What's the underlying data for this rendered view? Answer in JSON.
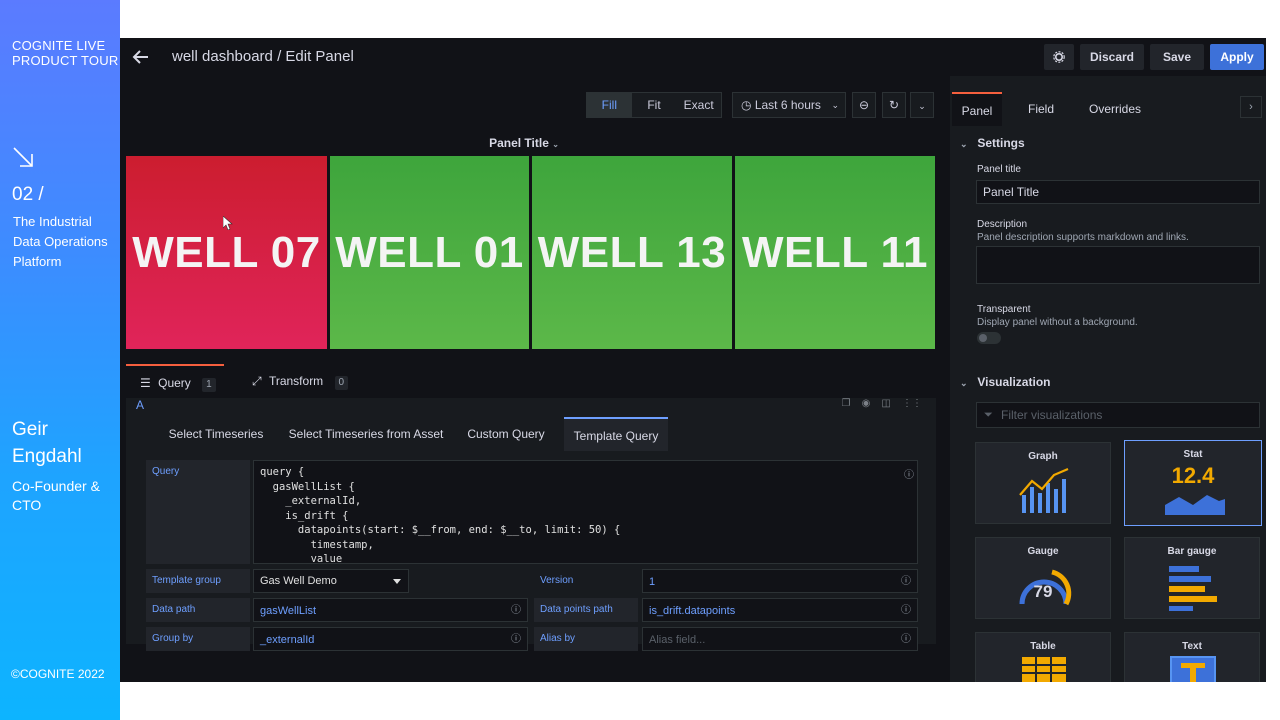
{
  "promo": {
    "brand_line1": "COGNITE LIVE",
    "brand_line2": "PRODUCT TOUR",
    "chapter_number": "02 /",
    "chapter_line1": "The Industrial",
    "chapter_line2": "Data Operations",
    "chapter_line3": "Platform",
    "person_first": "Geir",
    "person_last": "Engdahl",
    "role_line1": "Co-Founder &",
    "role_line2": "CTO",
    "copyright": "©COGNITE 2022"
  },
  "topbar": {
    "breadcrumb": "well dashboard / Edit Panel",
    "discard_label": "Discard",
    "save_label": "Save",
    "apply_label": "Apply"
  },
  "preview_controls": {
    "fill_label": "Fill",
    "fit_label": "Fit",
    "exact_label": "Exact",
    "time_range": "Last 6 hours"
  },
  "panel": {
    "title": "Panel Title",
    "stats": [
      {
        "label": "WELL 07",
        "status_color": "#d21f45"
      },
      {
        "label": "WELL 01",
        "status_color": "#4eae42"
      },
      {
        "label": "WELL 13",
        "status_color": "#4eae42"
      },
      {
        "label": "WELL 11",
        "status_color": "#4eae42"
      }
    ]
  },
  "query_tabs": {
    "query_label": "Query",
    "query_count": "1",
    "transform_label": "Transform",
    "transform_count": "0"
  },
  "query_editor": {
    "ref_id": "A",
    "subtabs": [
      "Select Timeseries",
      "Select Timeseries from Asset",
      "Custom Query",
      "Template Query"
    ],
    "active_subtab": "Template Query",
    "query_label": "Query",
    "query_text": "query {\n  gasWellList {\n    _externalId,\n    is_drift {\n      datapoints(start: $__from, end: $__to, limit: 50) {\n        timestamp,\n        value",
    "template_group_label": "Template group",
    "template_group_value": "Gas Well Demo",
    "version_label": "Version",
    "version_value": "1",
    "data_path_label": "Data path",
    "data_path_value": "gasWellList",
    "datapoints_path_label": "Data points path",
    "datapoints_path_value": "is_drift.datapoints",
    "group_by_label": "Group by",
    "group_by_value": "_externalId",
    "alias_by_label": "Alias by",
    "alias_by_placeholder": "Alias field..."
  },
  "options": {
    "tabs": [
      "Panel",
      "Field",
      "Overrides"
    ],
    "active_tab": "Panel",
    "settings_title": "Settings",
    "panel_title_label": "Panel title",
    "panel_title_value": "Panel Title",
    "description_label": "Description",
    "description_hint": "Panel description supports markdown and links.",
    "transparent_label": "Transparent",
    "transparent_hint": "Display panel without a background.",
    "visualization_title": "Visualization",
    "filter_placeholder": "Filter visualizations",
    "viz": [
      {
        "label": "Graph"
      },
      {
        "label": "Stat",
        "preview_value": "12.4"
      },
      {
        "label": "Gauge",
        "preview_value": "79"
      },
      {
        "label": "Bar gauge"
      },
      {
        "label": "Table"
      },
      {
        "label": "Text"
      }
    ],
    "selected_viz": "Stat"
  },
  "colors": {
    "accent_blue": "#3d71d9",
    "active_tab_orange": "#f55f3e",
    "link_blue": "#6e9fff"
  }
}
